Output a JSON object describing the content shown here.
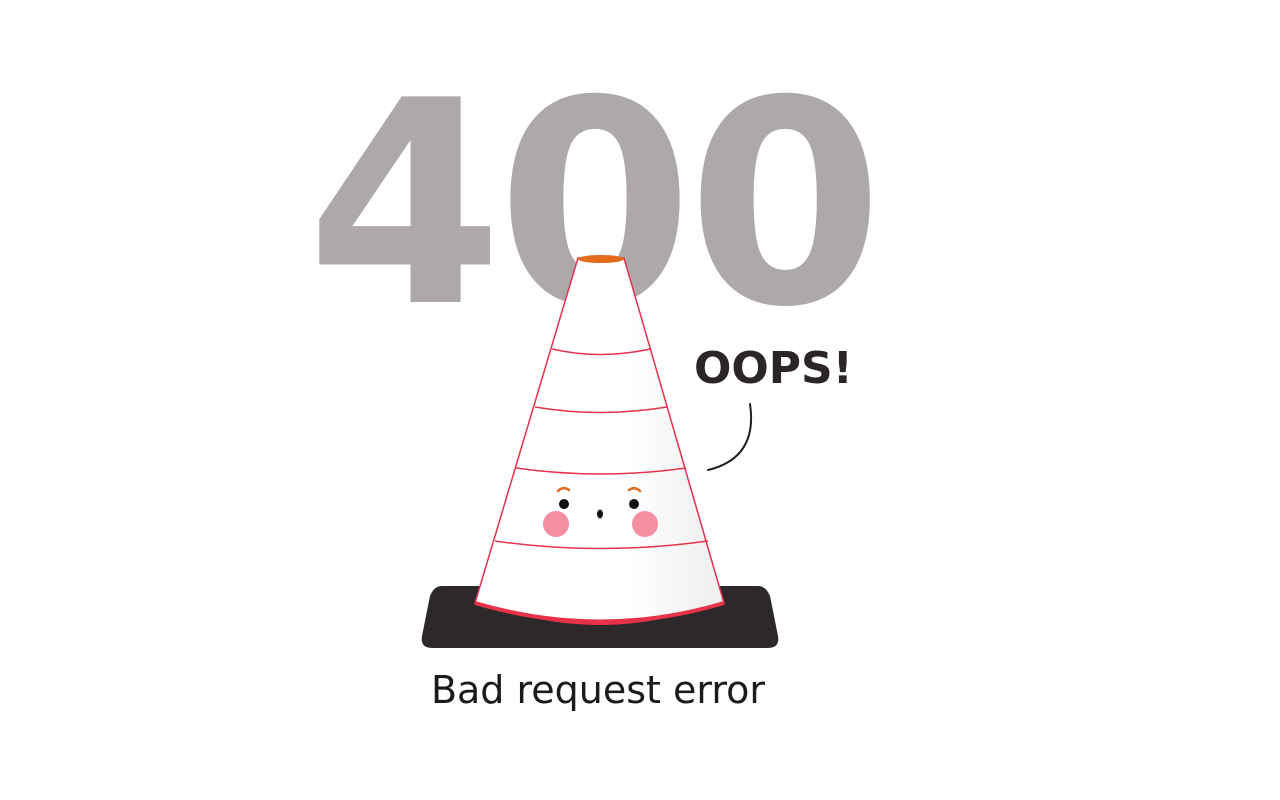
{
  "error_page": {
    "code": "400",
    "exclamation": "OOPS!",
    "message": "Bad request error"
  },
  "colors": {
    "code_gray": "#ada9aa",
    "cone_outline": "#e8324a",
    "cone_tip": "#e36b1c",
    "base": "#2d292a",
    "cheeks": "#f48fa1",
    "text_dark": "#231f20"
  },
  "icons": {
    "illustration": "traffic-cone-icon",
    "face": "cone-face-icon",
    "pointer": "speech-tail-icon"
  }
}
